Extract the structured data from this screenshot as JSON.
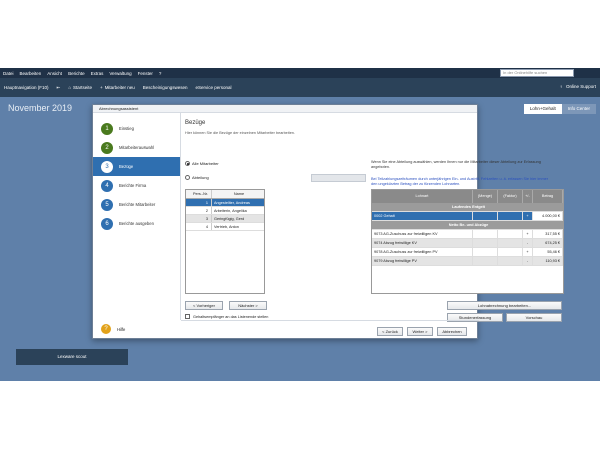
{
  "menubar": {
    "items": [
      "Datei",
      "Bearbeiten",
      "Ansicht",
      "Berichte",
      "Extras",
      "Verwaltung",
      "Fenster",
      "?"
    ],
    "search_placeholder": "In der Onlinehilfe suchen"
  },
  "toolbar": {
    "navigation": "Hauptnavigation (F10)",
    "start": "Startseite",
    "new_employee": "Mitarbeiter neu",
    "certificates": "Bescheinigungswesen",
    "eservice": "eService personal",
    "online_support": "Online Support"
  },
  "desktop": {
    "month": "November 2019",
    "tabs": [
      "Lohn+Gehalt",
      "Info Center"
    ],
    "scout": "Lexware scout"
  },
  "dialog": {
    "title": "Abrechnungsassistent",
    "steps": [
      {
        "n": "1",
        "label": "Einstieg",
        "state": "done"
      },
      {
        "n": "2",
        "label": "Mitarbeiterauswahl",
        "state": "done"
      },
      {
        "n": "3",
        "label": "Bezüge",
        "state": "current"
      },
      {
        "n": "4",
        "label": "Berichte Firma",
        "state": "todo"
      },
      {
        "n": "5",
        "label": "Berichte Mitarbeiter",
        "state": "todo"
      },
      {
        "n": "6",
        "label": "Berichte ausgeben",
        "state": "todo"
      }
    ],
    "help": "Hilfe",
    "content_title": "Bezüge",
    "content_sub": "Hier können Sie die Bezüge der einzelnen Mitarbeiter bearbeiten.",
    "radio_all": "Alle Mitarbeiter",
    "radio_dept": "Abteilung",
    "info1": "Wenn Sie eine Abteilung auswählen, werden Ihnen nur die Mitarbeiter dieser Abteilung zur Erfassung angeboten.",
    "info2": "Bei Teilzahlungszeiträumen durch unterjährigen Ein- und Austritt, Fehlzeiten u. ä. erfassen Sie hier immer den ungekürzten Betrag der zu fürzenden Lohnarten.",
    "emp_headers": [
      "Pers.-Nr.",
      "Name"
    ],
    "employees": [
      {
        "nr": "1",
        "name": "Angestellter, Andreas"
      },
      {
        "nr": "2",
        "name": "Arbeiterin, Angelika"
      },
      {
        "nr": "3",
        "name": "Geringfügig, Gerd"
      },
      {
        "nr": "4",
        "name": "Vertrieb, Anton"
      }
    ],
    "lohn_headers": [
      "Lohnart",
      "(Menge)",
      "(Faktor)",
      "+/-",
      "Betrag"
    ],
    "group1": "Laufendes Entgelt",
    "gehalt": {
      "name": "0002 Gehalt",
      "sign": "+",
      "amount": "4.000,00 €"
    },
    "group2": "Netto Be- und Abzüge",
    "net_rows": [
      {
        "name": "9073 AG-Zuschuss zur freiwilligen KV",
        "sign": "+",
        "amount": "317,55 €"
      },
      {
        "name": "9074 Abzug freiwillige KV",
        "sign": "-",
        "amount": "674,25 €"
      },
      {
        "name": "9078 AG-Zuschuss zur freiwilligen PV",
        "sign": "+",
        "amount": "55,46 €"
      },
      {
        "name": "9079 Abzug freiwillige PV",
        "sign": "-",
        "amount": "110,93 €"
      }
    ],
    "btn_prev": "< Vorheriger",
    "btn_next_emp": "Nächster >",
    "btn_edit": "Lohnabrechnung bearbeiten...",
    "btn_hours": "Stundenerfassung",
    "btn_preview": "Vorschau",
    "checkbox": "Gehaltsempfänger an das Listenende stellen",
    "btn_back": "< Zurück",
    "btn_forward": "Weiter >",
    "btn_cancel": "Abbrechen"
  }
}
